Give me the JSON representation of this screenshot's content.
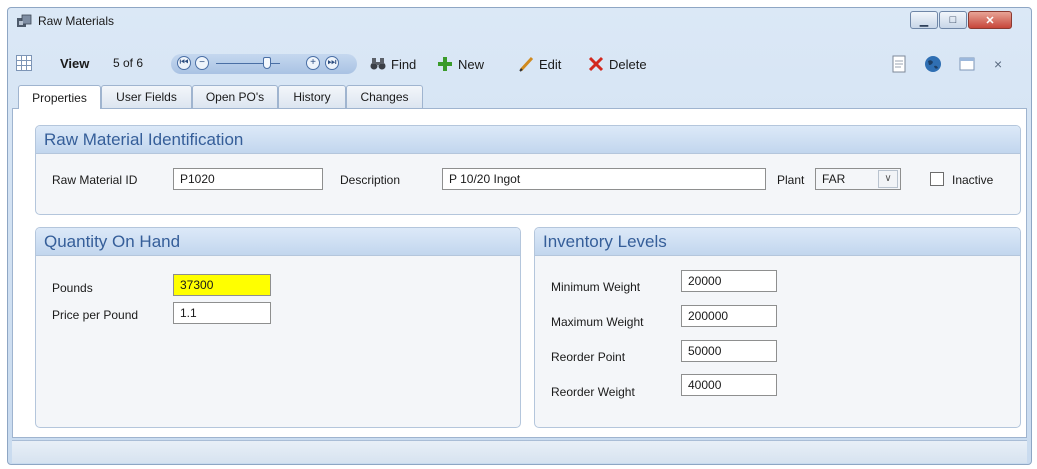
{
  "window": {
    "title": "Raw Materials",
    "minimize_glyph": "▁",
    "maximize_glyph": "□",
    "close_glyph": "✕"
  },
  "toolbar": {
    "view_label": "View",
    "record_position": "5 of 6",
    "find_label": "Find",
    "new_label": "New",
    "edit_label": "Edit",
    "delete_label": "Delete",
    "close_glyph": "×"
  },
  "tabs": [
    {
      "label": "Properties",
      "active": true
    },
    {
      "label": "User Fields"
    },
    {
      "label": "Open PO's"
    },
    {
      "label": "History"
    },
    {
      "label": "Changes"
    }
  ],
  "identification": {
    "title": "Raw Material Identification",
    "id_label": "Raw Material ID",
    "id_value": "P1020",
    "description_label": "Description",
    "description_value": "P 10/20 Ingot",
    "plant_label": "Plant",
    "plant_value": "FAR",
    "inactive_label": "Inactive",
    "inactive_checked": false
  },
  "quantity": {
    "title": "Quantity On Hand",
    "pounds_label": "Pounds",
    "pounds_value": "37300",
    "price_label": "Price per Pound",
    "price_value": "1.1"
  },
  "inventory": {
    "title": "Inventory Levels",
    "min_label": "Minimum Weight",
    "min_value": "20000",
    "max_label": "Maximum Weight",
    "max_value": "200000",
    "reorder_point_label": "Reorder Point",
    "reorder_point_value": "50000",
    "reorder_weight_label": "Reorder Weight",
    "reorder_weight_value": "40000"
  },
  "colors": {
    "accent": "#355e99",
    "highlight": "#ffff00",
    "delete_red": "#d2281e",
    "new_green": "#3a9b2a"
  },
  "icons": [
    "app-icon",
    "grid-icon",
    "first-record-icon",
    "zoom-out-icon",
    "zoom-in-icon",
    "last-record-icon",
    "binoculars-icon",
    "plus-icon",
    "pencil-icon",
    "delete-x-icon",
    "document-icon",
    "globe-icon",
    "window-icon",
    "chevron-down-icon"
  ]
}
